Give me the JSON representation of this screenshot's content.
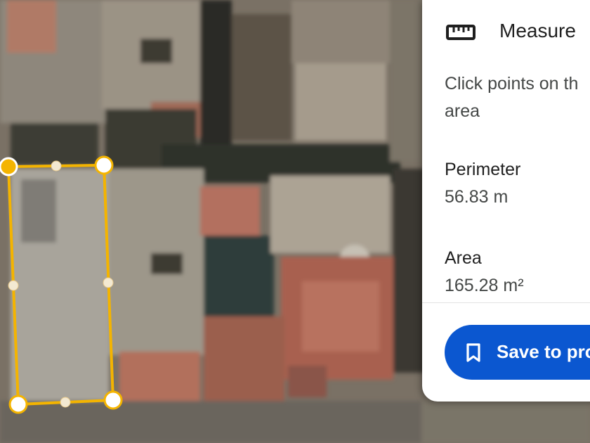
{
  "map": {
    "type": "satellite",
    "measurement_color": "#f4b400"
  },
  "measure_panel": {
    "title": "Measure",
    "icon": "ruler-icon",
    "instructions_line1": "Click points on th",
    "instructions_line2": "area",
    "perimeter_label": "Perimeter",
    "perimeter_value": "56.83 m",
    "area_label": "Area",
    "area_value": "165.28 m²",
    "save_button_label": "Save to pro",
    "save_icon": "bookmark-icon",
    "accent_color": "#0b57d0"
  }
}
